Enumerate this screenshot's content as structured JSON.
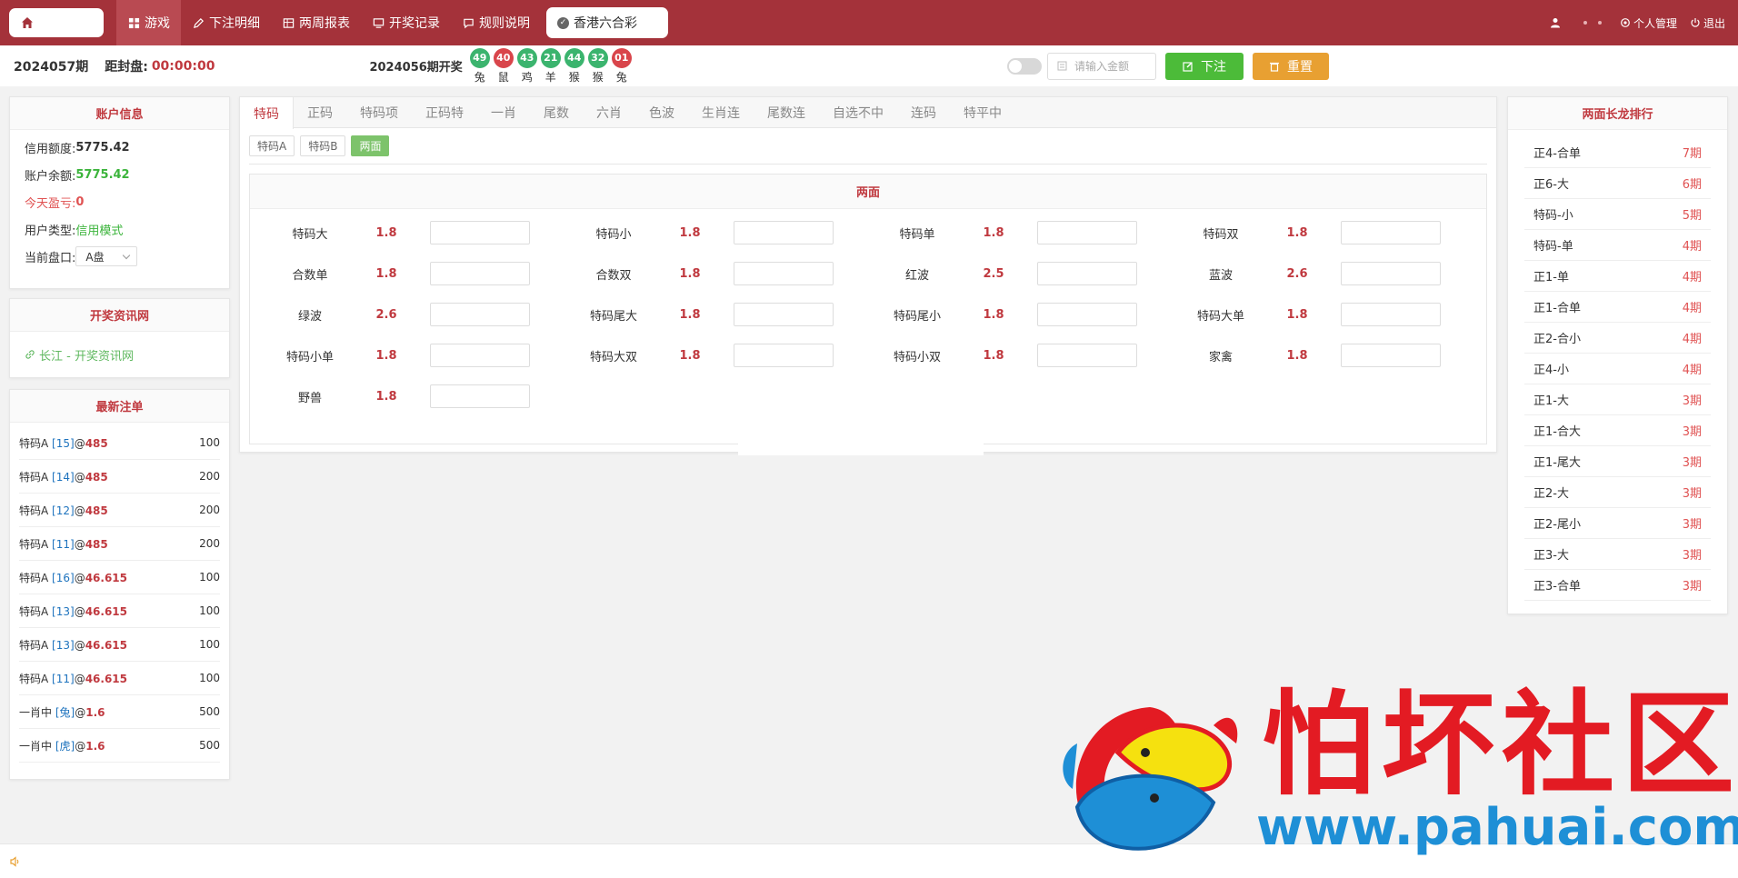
{
  "nav": {
    "items": [
      {
        "label": "游戏",
        "icon": "grid-icon"
      },
      {
        "label": "下注明细",
        "icon": "pencil-icon"
      },
      {
        "label": "两周报表",
        "icon": "table-icon"
      },
      {
        "label": "开奖记录",
        "icon": "monitor-icon"
      },
      {
        "label": "规则说明",
        "icon": "chat-icon"
      }
    ],
    "lottery": "香港六合彩",
    "profile": "个人管理",
    "logout": "退出"
  },
  "status": {
    "period": "2024057期",
    "close_label": "距封盘:",
    "close_time": "00:00:00",
    "last_draw_label": "2024056期开奖",
    "balls": [
      {
        "num": "49",
        "zodiac": "兔",
        "color": "#3bb46e"
      },
      {
        "num": "40",
        "zodiac": "鼠",
        "color": "#d9454b"
      },
      {
        "num": "43",
        "zodiac": "鸡",
        "color": "#3bb46e"
      },
      {
        "num": "21",
        "zodiac": "羊",
        "color": "#3bb46e"
      },
      {
        "num": "44",
        "zodiac": "猴",
        "color": "#3bb46e"
      },
      {
        "num": "32",
        "zodiac": "猴",
        "color": "#3bb46e"
      },
      {
        "num": "01",
        "zodiac": "兔",
        "color": "#d9454b"
      }
    ],
    "amount_placeholder": "请输入金额",
    "bet_label": "下注",
    "reset_label": "重置"
  },
  "account": {
    "title": "账户信息",
    "credit_label": "信用额度:",
    "credit_value": "5775.42",
    "balance_label": "账户余额:",
    "balance_value": "5775.42",
    "profit_label": "今天盈亏:",
    "profit_value": "0",
    "type_label": "用户类型:",
    "type_value": "信用模式",
    "plate_label": "当前盘口:",
    "plate_value": "A盘"
  },
  "news": {
    "title": "开奖资讯网",
    "link": "长江 - 开奖资讯网"
  },
  "recent": {
    "title": "最新注单",
    "rows": [
      {
        "name": "特码A",
        "sel": "[15]",
        "odds": "485",
        "amount": "100"
      },
      {
        "name": "特码A",
        "sel": "[14]",
        "odds": "485",
        "amount": "200"
      },
      {
        "name": "特码A",
        "sel": "[12]",
        "odds": "485",
        "amount": "200"
      },
      {
        "name": "特码A",
        "sel": "[11]",
        "odds": "485",
        "amount": "200"
      },
      {
        "name": "特码A",
        "sel": "[16]",
        "odds": "46.615",
        "amount": "100"
      },
      {
        "name": "特码A",
        "sel": "[13]",
        "odds": "46.615",
        "amount": "100"
      },
      {
        "name": "特码A",
        "sel": "[13]",
        "odds": "46.615",
        "amount": "100"
      },
      {
        "name": "特码A",
        "sel": "[11]",
        "odds": "46.615",
        "amount": "100"
      },
      {
        "name": "一肖中",
        "sel": "[兔]",
        "odds": "1.6",
        "amount": "500"
      },
      {
        "name": "一肖中",
        "sel": "[虎]",
        "odds": "1.6",
        "amount": "500"
      }
    ]
  },
  "tabs": [
    "特码",
    "正码",
    "特码项",
    "正码特",
    "一肖",
    "尾数",
    "六肖",
    "色波",
    "生肖连",
    "尾数连",
    "自选不中",
    "连码",
    "特平中"
  ],
  "subtabs": [
    "特码A",
    "特码B",
    "两面"
  ],
  "section": {
    "title": "两面",
    "options": [
      {
        "name": "特码大",
        "odds": "1.8"
      },
      {
        "name": "特码小",
        "odds": "1.8"
      },
      {
        "name": "特码单",
        "odds": "1.8"
      },
      {
        "name": "特码双",
        "odds": "1.8"
      },
      {
        "name": "合数单",
        "odds": "1.8"
      },
      {
        "name": "合数双",
        "odds": "1.8"
      },
      {
        "name": "红波",
        "odds": "2.5"
      },
      {
        "name": "蓝波",
        "odds": "2.6"
      },
      {
        "name": "绿波",
        "odds": "2.6"
      },
      {
        "name": "特码尾大",
        "odds": "1.8"
      },
      {
        "name": "特码尾小",
        "odds": "1.8"
      },
      {
        "name": "特码大单",
        "odds": "1.8"
      },
      {
        "name": "特码小单",
        "odds": "1.8"
      },
      {
        "name": "特码大双",
        "odds": "1.8"
      },
      {
        "name": "特码小双",
        "odds": "1.8"
      },
      {
        "name": "家禽",
        "odds": "1.8"
      },
      {
        "name": "野兽",
        "odds": "1.8"
      }
    ]
  },
  "ranking": {
    "title": "两面长龙排行",
    "rows": [
      {
        "name": "正4-合单",
        "count": "7期"
      },
      {
        "name": "正6-大",
        "count": "6期"
      },
      {
        "name": "特码-小",
        "count": "5期"
      },
      {
        "name": "特码-单",
        "count": "4期"
      },
      {
        "name": "正1-单",
        "count": "4期"
      },
      {
        "name": "正1-合单",
        "count": "4期"
      },
      {
        "name": "正2-合小",
        "count": "4期"
      },
      {
        "name": "正4-小",
        "count": "4期"
      },
      {
        "name": "正1-大",
        "count": "3期"
      },
      {
        "name": "正1-合大",
        "count": "3期"
      },
      {
        "name": "正1-尾大",
        "count": "3期"
      },
      {
        "name": "正2-大",
        "count": "3期"
      },
      {
        "name": "正2-尾小",
        "count": "3期"
      },
      {
        "name": "正3-大",
        "count": "3期"
      },
      {
        "name": "正3-合单",
        "count": "3期"
      }
    ]
  },
  "watermark": {
    "cn": "怕坏社区",
    "url": "www.pahuai.com"
  },
  "colors": {
    "brand": "#a4323a",
    "accent_red": "#c0393f",
    "green": "#4cbb39",
    "orange": "#e8a032"
  }
}
